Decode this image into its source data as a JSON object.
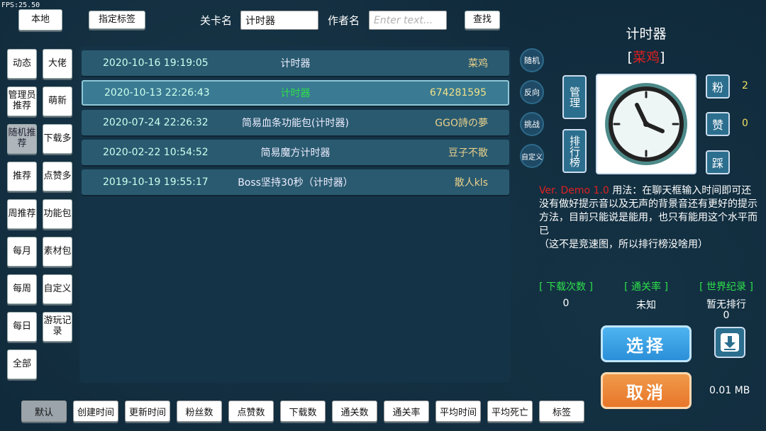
{
  "fps": "FPS:25.50",
  "top": {
    "local_btn": "本地",
    "tag_btn": "指定标签",
    "level_label": "关卡名",
    "level_value": "计时器",
    "author_label": "作者名",
    "author_placeholder": "Enter text...",
    "search_btn": "查找"
  },
  "side_left": [
    "动态",
    "管理员推荐",
    "随机推荐",
    "推荐",
    "周推荐",
    "每月",
    "每周",
    "每日",
    "全部"
  ],
  "side_right": [
    "大佬",
    "萌新",
    "下载多",
    "点赞多",
    "功能包",
    "素材包",
    "自定义",
    "游玩记录"
  ],
  "rows": [
    {
      "date": "2020-10-16 19:19:05",
      "title": "计时器",
      "author": "菜鸡"
    },
    {
      "date": "2020-10-13 22:26:43",
      "title": "计时器",
      "author": "674281595"
    },
    {
      "date": "2020-07-24 22:26:32",
      "title": "简易血条功能包(计时器)",
      "author": "GGO詩の夢"
    },
    {
      "date": "2020-02-22 10:54:52",
      "title": "简易魔方计时器",
      "author": "豆子不散"
    },
    {
      "date": "2019-10-19 19:55:17",
      "title": "Boss坚持30秒（计时器）",
      "author": "散人kls"
    }
  ],
  "circle_btns": [
    "随机",
    "反向",
    "挑战",
    "自定义"
  ],
  "manage_btn": "管理",
  "rank_btn": "排行榜",
  "detail": {
    "title": "计时器",
    "author_open": "[",
    "author": "菜鸡",
    "author_close": "]",
    "version": "Ver. Demo 1.0",
    "description": " 用法：在聊天框输入时间即可还没有做好提示音以及无声的背景音还有更好的提示方法，目前只能说是能用，也只有能用这个水平而已\n（这不是竞速图，所以排行榜没啥用）",
    "fans_label": "粉",
    "fans_count": "2",
    "like_label": "赞",
    "like_count": "0",
    "dislike_label": "踩",
    "downloads_label": "[ 下载次数 ]",
    "downloads": "0",
    "pass_rate_label": "[ 通关率 ]",
    "pass_rate": "未知",
    "record_label": "[ 世界纪录 ]",
    "record": "暂无排行",
    "record_value": "0",
    "select_btn": "选择",
    "cancel_btn": "取消",
    "size": "0.01 MB"
  },
  "sort_btns": [
    "默认",
    "创建时间",
    "更新时间",
    "粉丝数",
    "点赞数",
    "下载数",
    "通关数",
    "通关率",
    "平均时间",
    "平均死亡",
    "标签"
  ],
  "colors": {
    "background": "#102a3b",
    "active_title": "#2ee04a",
    "author_red": "#e02020",
    "select_blue": "#2a8fd8",
    "cancel_orange": "#e8762a"
  }
}
